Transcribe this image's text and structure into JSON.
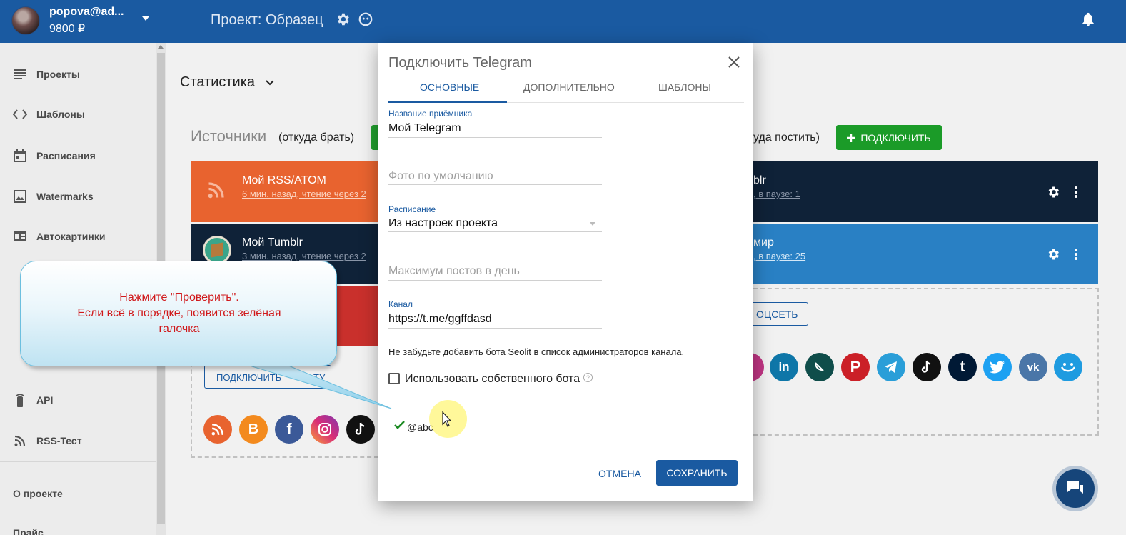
{
  "topbar": {
    "user_name": "popova@ad...",
    "balance": "9800 ₽",
    "project_title": "Проект: Образец"
  },
  "sidebar": {
    "items": [
      {
        "label": "Проекты",
        "icon": "list-icon"
      },
      {
        "label": "Шаблоны",
        "icon": "code-icon"
      },
      {
        "label": "Расписания",
        "icon": "calendar-icon"
      },
      {
        "label": "Watermarks",
        "icon": "image-icon"
      },
      {
        "label": "Автокартинки",
        "icon": "autoimage-icon"
      },
      {
        "label": "API",
        "icon": "api-icon"
      },
      {
        "label": "RSS-Тест",
        "icon": "rss-icon"
      }
    ],
    "about": "О проекте",
    "more": "Прайс"
  },
  "main": {
    "stats_label": "Статистика",
    "sources_title": "Источники",
    "sources_sub": "(откуда брать)",
    "dest_sub": "уда постить)",
    "connect_label": "ПОДКЛЮЧИТЬ",
    "cards_left": [
      {
        "title": "Мой RSS/ATOM",
        "sub": "6 мин. назад, чтение через 2"
      },
      {
        "title": "Мой Tumblr",
        "sub": "3 мин. назад, чтение через 2"
      }
    ],
    "cards_right": [
      {
        "title": "blr",
        "sub": ", в паузе: 1"
      },
      {
        "title": "мир",
        "sub": ", в паузе: 25"
      }
    ],
    "left_outline_btn": "ПОДКЛЮЧИТЬ",
    "left_outline_btn_tail": "ТУ",
    "right_outline_btn": "ОЦСЕТЬ"
  },
  "modal": {
    "title": "Подключить Telegram",
    "tabs": [
      "ОСНОВНЫЕ",
      "ДОПОЛНИТЕЛЬНО",
      "ШАБЛОНЫ"
    ],
    "receiver_label": "Название приёмника",
    "receiver_value": "Мой Telegram",
    "photo_placeholder": "Фото по умолчанию",
    "schedule_label": "Расписание",
    "schedule_value": "Из настроек проекта",
    "max_posts_placeholder": "Максимум постов в день",
    "channel_label": "Канал",
    "channel_value": "https://t.me/ggffdasd",
    "note": "Не забудьте добавить бота Seolit в список администраторов канала.",
    "own_bot_label": "Использовать собственного бота",
    "bot_name": "@abc",
    "cancel_label": "ОТМЕНА",
    "save_label": "СОХРАНИТЬ"
  },
  "callout": {
    "line1": "Нажмите \"Проверить\".",
    "line2": "Если всё в порядке, появится зелёная",
    "line3": "галочка"
  },
  "colors": {
    "brand": "#1a5aa1",
    "success": "#1b9b28",
    "rss": "#e8632f",
    "tumblr": "#0f2238",
    "callout_text": "#d0191b"
  }
}
